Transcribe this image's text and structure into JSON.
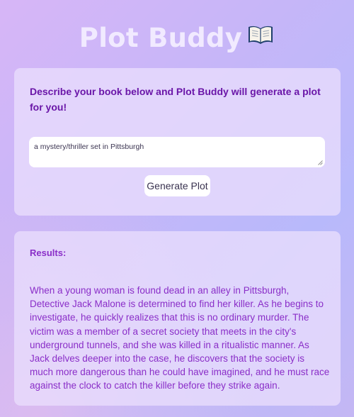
{
  "header": {
    "title": "Plot Buddy",
    "title_icon": "open-book-icon"
  },
  "prompt_card": {
    "instruction": "Describe your book below and Plot Buddy will generate a plot for you!",
    "input_value": "a mystery/thriller set in Pittsburgh",
    "button_label": "Generate Plot"
  },
  "results_card": {
    "label": "Results:",
    "text": "When a young woman is found dead in an alley in Pittsburgh, Detective Jack Malone is determined to find her killer. As he begins to investigate, he quickly realizes that this is no ordinary murder. The victim was a member of a secret society that meets in the city's underground tunnels, and she was killed in a ritualistic manner. As Jack delves deeper into the case, he discovers that the society is much more dangerous than he could have imagined, and he must race against the clock to catch the killer before they strike again."
  },
  "colors": {
    "title": "#f1eaff",
    "instruction_text": "#6a16a8",
    "results_text": "#8a2ec8",
    "card_background": "#e9defd"
  }
}
